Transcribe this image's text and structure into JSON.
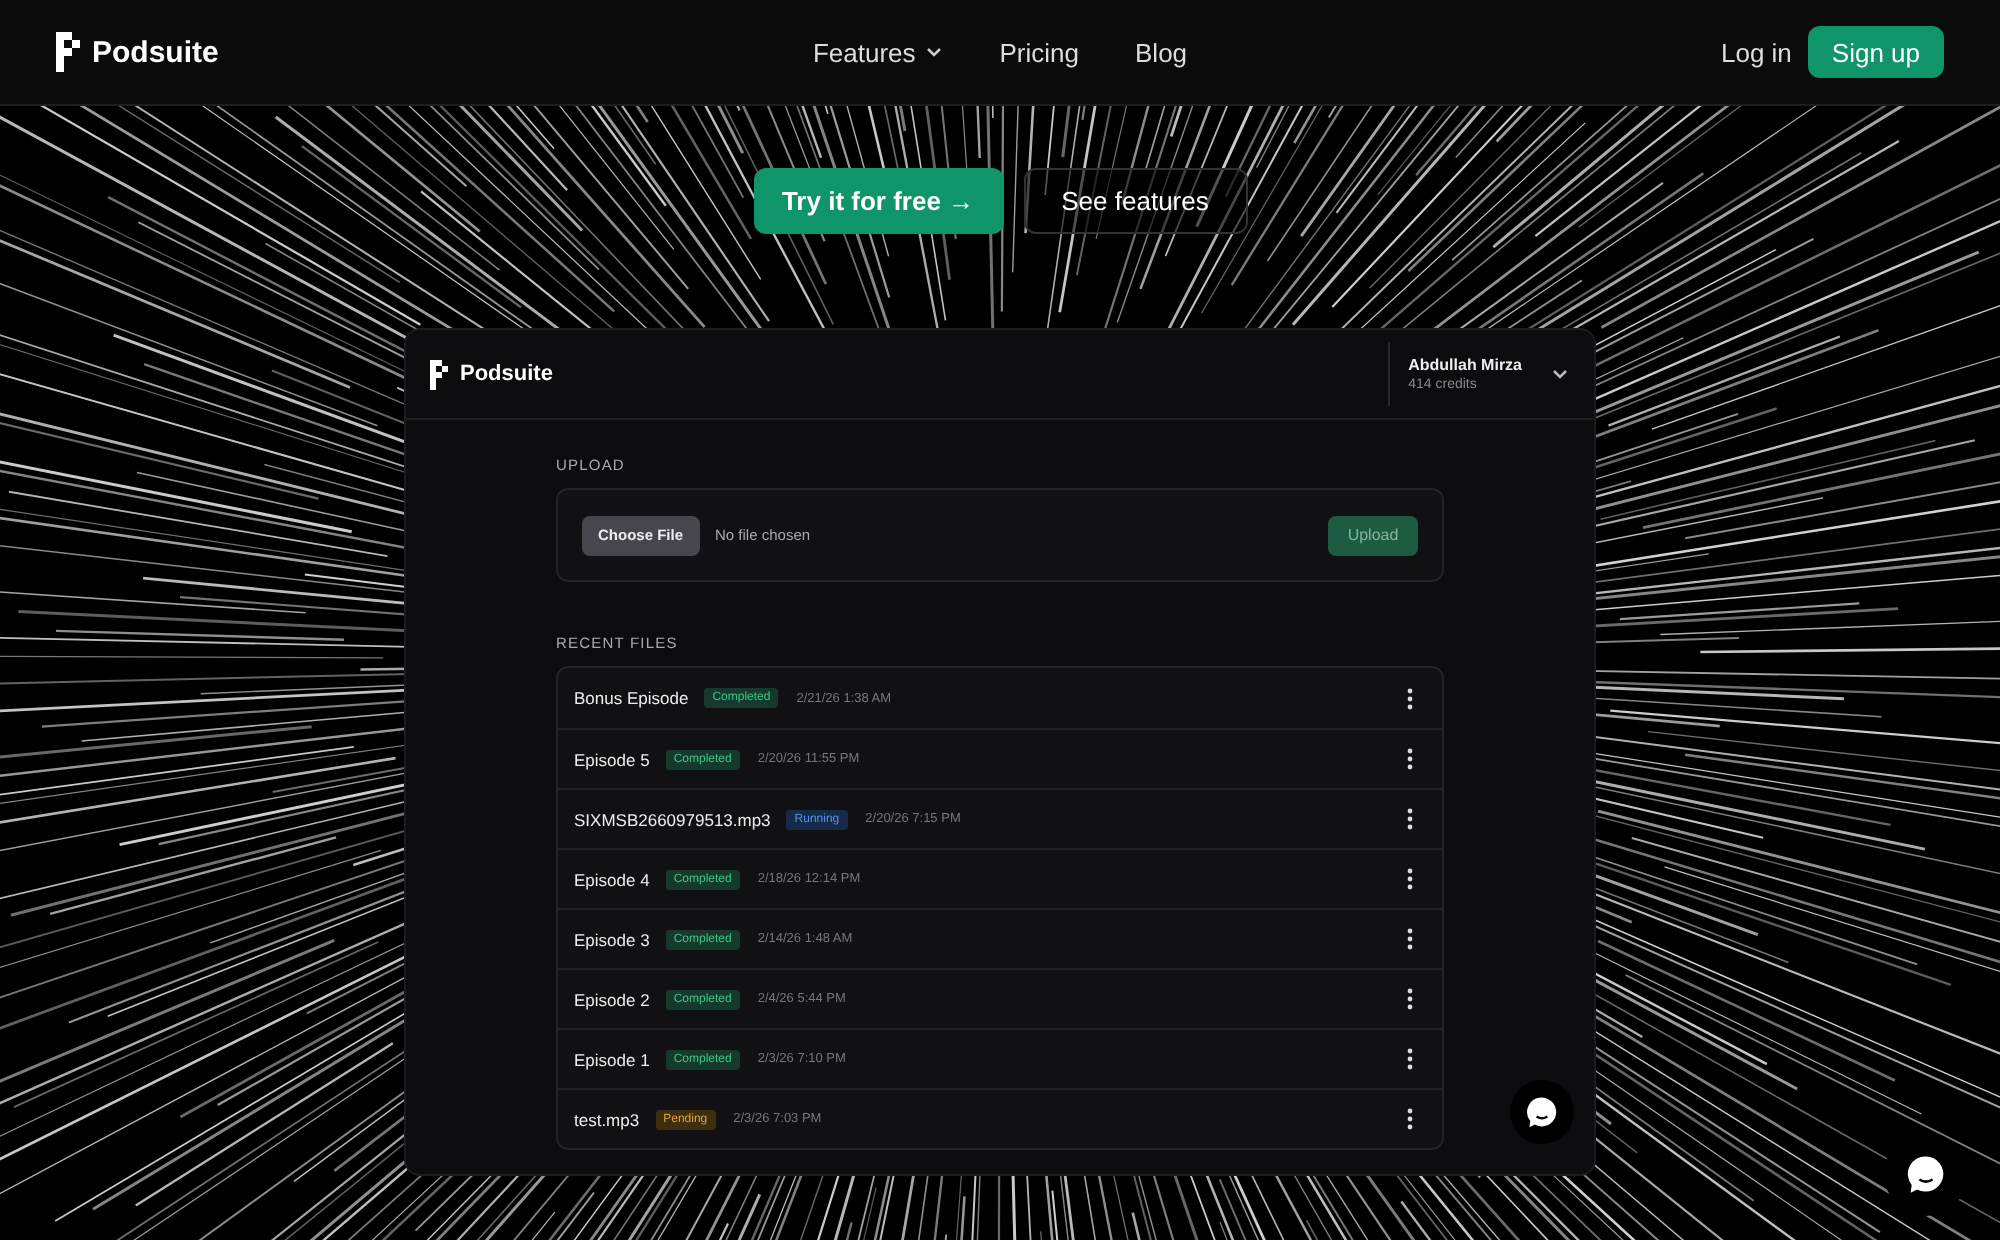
{
  "nav": {
    "brand": "Podsuite",
    "links": [
      {
        "label": "Features",
        "has_menu": true
      },
      {
        "label": "Pricing",
        "has_menu": false
      },
      {
        "label": "Blog",
        "has_menu": false
      }
    ],
    "login": "Log in",
    "signup": "Sign up"
  },
  "hero": {
    "primary": "Try it for free →",
    "secondary": "See features"
  },
  "app": {
    "brand": "Podsuite",
    "user": {
      "name": "Abdullah Mirza",
      "credits": "414 credits"
    },
    "upload": {
      "heading": "UPLOAD",
      "choose": "Choose File",
      "status": "No file chosen",
      "button": "Upload",
      "disabled": true
    },
    "recent": {
      "heading": "RECENT FILES",
      "files": [
        {
          "name": "Bonus Episode",
          "status": "Completed",
          "kind": "completed",
          "time": "2/21/26 1:38 AM"
        },
        {
          "name": "Episode 5",
          "status": "Completed",
          "kind": "completed",
          "time": "2/20/26 11:55 PM"
        },
        {
          "name": "SIXMSB2660979513.mp3",
          "status": "Running",
          "kind": "running",
          "time": "2/20/26 7:15 PM"
        },
        {
          "name": "Episode 4",
          "status": "Completed",
          "kind": "completed",
          "time": "2/18/26 12:14 PM"
        },
        {
          "name": "Episode 3",
          "status": "Completed",
          "kind": "completed",
          "time": "2/14/26 1:48 AM"
        },
        {
          "name": "Episode 2",
          "status": "Completed",
          "kind": "completed",
          "time": "2/4/26 5:44 PM"
        },
        {
          "name": "Episode 1",
          "status": "Completed",
          "kind": "completed",
          "time": "2/3/26 7:10 PM"
        },
        {
          "name": "test.mp3",
          "status": "Pending",
          "kind": "pending",
          "time": "2/3/26 7:03 PM"
        }
      ]
    }
  }
}
